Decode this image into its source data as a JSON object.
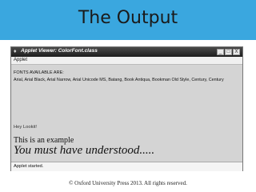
{
  "slide": {
    "title": "The Output",
    "copyright": "© Oxford University Press 2013. All rights reserved."
  },
  "window": {
    "title": "Applet Viewer: ColorFont.class",
    "buttons": [
      "_",
      "□",
      "X"
    ],
    "menu_label": "Applet",
    "status": "Applet started."
  },
  "content": {
    "fonts_label": "FONTS AVAILABLE ARE:",
    "fonts_list": "Arial, Arial Black, Arial Narrow, Arial Unicode MS, Batang, Book Antiqua, Bookman Old Style, Century, Century",
    "hey": "Hey Lookit!",
    "example": "This is an example",
    "understood": "You must have understood....."
  }
}
